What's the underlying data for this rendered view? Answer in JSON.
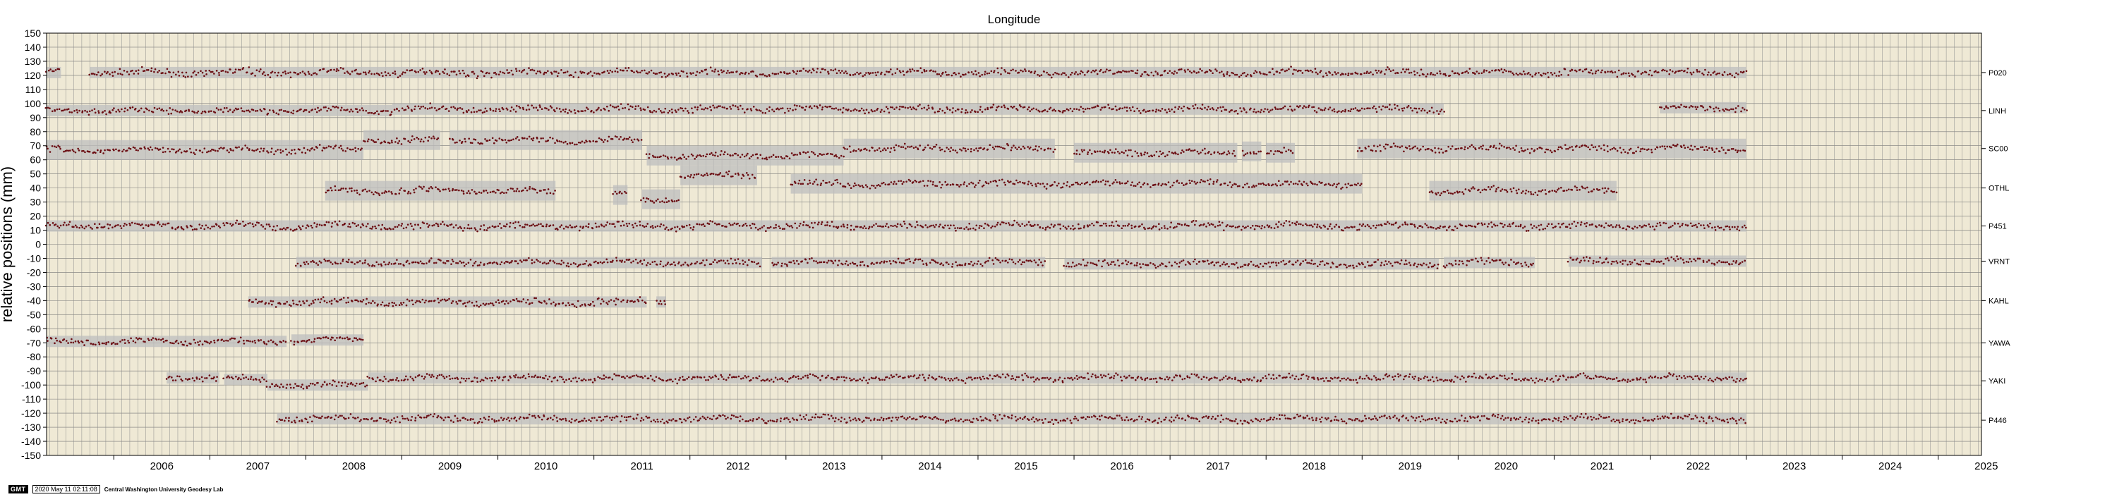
{
  "chart_data": {
    "type": "scatter",
    "title": "Longitude",
    "ylabel": "relative positions (mm)",
    "xlim": [
      2005.3,
      2025.45
    ],
    "ylim": [
      -150,
      150
    ],
    "y_ticks": [
      150,
      140,
      130,
      120,
      110,
      100,
      90,
      80,
      70,
      60,
      50,
      40,
      30,
      20,
      10,
      0,
      -10,
      -20,
      -30,
      -40,
      -50,
      -60,
      -70,
      -80,
      -90,
      -100,
      -110,
      -120,
      -130,
      -140,
      -150
    ],
    "x_ticks": [
      "2006",
      "2007",
      "2008",
      "2009",
      "2010",
      "2011",
      "2012",
      "2013",
      "2014",
      "2015",
      "2016",
      "2017",
      "2018",
      "2019",
      "2020",
      "2021",
      "2022",
      "2023",
      "2024",
      "2025"
    ],
    "grid": true,
    "point_color": "#6b0d12",
    "error_band_color": "#bdbdbd",
    "background_color": "#efe9d5",
    "series": [
      {
        "name": "P020",
        "offset": 122,
        "segments": [
          [
            2005.3,
            2005.45,
            122
          ],
          [
            2005.75,
            2014.3,
            122
          ],
          [
            2014.3,
            2023.0,
            122
          ]
        ]
      },
      {
        "name": "LINH",
        "offset": 95,
        "segments": [
          [
            2005.3,
            2005.95,
            95
          ],
          [
            2005.95,
            2008.9,
            95
          ],
          [
            2008.9,
            2019.85,
            96
          ],
          [
            2022.1,
            2023.0,
            97
          ]
        ]
      },
      {
        "name": "SC00",
        "offset": 68,
        "segments": [
          [
            2005.3,
            2008.6,
            67
          ],
          [
            2008.6,
            2009.4,
            74
          ],
          [
            2009.5,
            2011.5,
            74
          ],
          [
            2011.55,
            2013.6,
            63
          ],
          [
            2013.6,
            2015.8,
            68
          ],
          [
            2016.0,
            2017.7,
            65
          ],
          [
            2017.75,
            2017.95,
            66
          ],
          [
            2018.0,
            2018.3,
            65
          ],
          [
            2018.95,
            2023.0,
            68
          ]
        ]
      },
      {
        "name": "OTHL",
        "offset": 40,
        "segments": [
          [
            2008.2,
            2010.6,
            38
          ],
          [
            2011.2,
            2011.35,
            35
          ],
          [
            2011.5,
            2011.9,
            32
          ],
          [
            2011.9,
            2012.7,
            49
          ],
          [
            2013.05,
            2019.0,
            43
          ],
          [
            2019.7,
            2021.65,
            38
          ]
        ]
      },
      {
        "name": "P451",
        "offset": 13,
        "segments": [
          [
            2005.3,
            2023.0,
            13
          ]
        ]
      },
      {
        "name": "VRNT",
        "offset": -12,
        "segments": [
          [
            2007.9,
            2012.75,
            -13
          ],
          [
            2012.85,
            2015.7,
            -13
          ],
          [
            2015.9,
            2019.8,
            -14
          ],
          [
            2019.85,
            2020.8,
            -13
          ],
          [
            2021.15,
            2023.0,
            -12
          ]
        ]
      },
      {
        "name": "KAHL",
        "offset": -40,
        "segments": [
          [
            2007.4,
            2011.55,
            -41
          ],
          [
            2011.65,
            2011.75,
            -41
          ]
        ]
      },
      {
        "name": "YAWA",
        "offset": -70,
        "segments": [
          [
            2005.3,
            2007.8,
            -69
          ],
          [
            2007.85,
            2008.6,
            -68
          ]
        ]
      },
      {
        "name": "YAKI",
        "offset": -97,
        "segments": [
          [
            2006.55,
            2007.1,
            -95
          ],
          [
            2007.15,
            2007.6,
            -96
          ],
          [
            2007.6,
            2008.65,
            -100
          ],
          [
            2008.65,
            2023.0,
            -95
          ]
        ]
      },
      {
        "name": "P446",
        "offset": -125,
        "segments": [
          [
            2007.7,
            2023.0,
            -124
          ]
        ]
      }
    ]
  },
  "footer": {
    "logo": "GMT",
    "timestamp": "2020 May 11 02:11:08",
    "credit": "Central Washington University Geodesy Lab"
  }
}
